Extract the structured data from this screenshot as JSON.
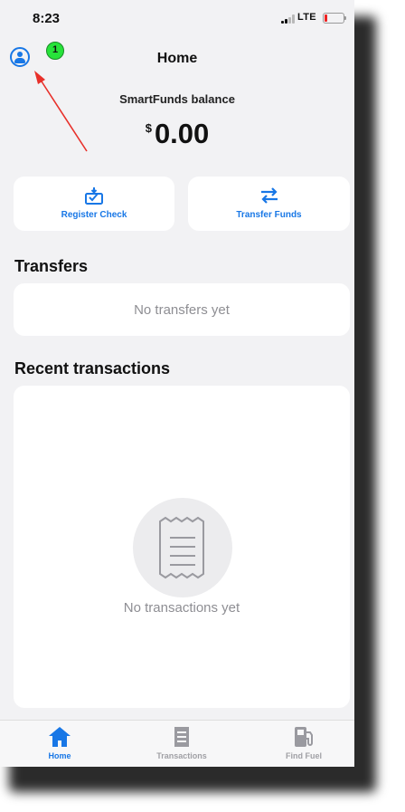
{
  "status_bar": {
    "time": "8:23",
    "network": "LTE"
  },
  "header": {
    "title": "Home",
    "badge": "1"
  },
  "balance": {
    "label": "SmartFunds balance",
    "currency": "$",
    "amount": "0.00"
  },
  "actions": [
    {
      "label": "Register Check",
      "icon": "check-deposit-icon"
    },
    {
      "label": "Transfer Funds",
      "icon": "transfer-arrows-icon"
    }
  ],
  "transfers": {
    "heading": "Transfers",
    "empty_text": "No transfers yet"
  },
  "transactions": {
    "heading": "Recent transactions",
    "empty_text": "No transactions yet",
    "icon": "receipt-icon"
  },
  "tabs": [
    {
      "label": "Home",
      "icon": "home-icon",
      "active": true
    },
    {
      "label": "Transactions",
      "icon": "receipt-icon",
      "active": false
    },
    {
      "label": "Find Fuel",
      "icon": "fuel-pump-icon",
      "active": false
    }
  ],
  "colors": {
    "accent": "#1877e6",
    "background": "#f2f2f4",
    "muted": "#8e8e93",
    "badge": "#27e33a",
    "annotation_arrow": "#e8302a"
  }
}
